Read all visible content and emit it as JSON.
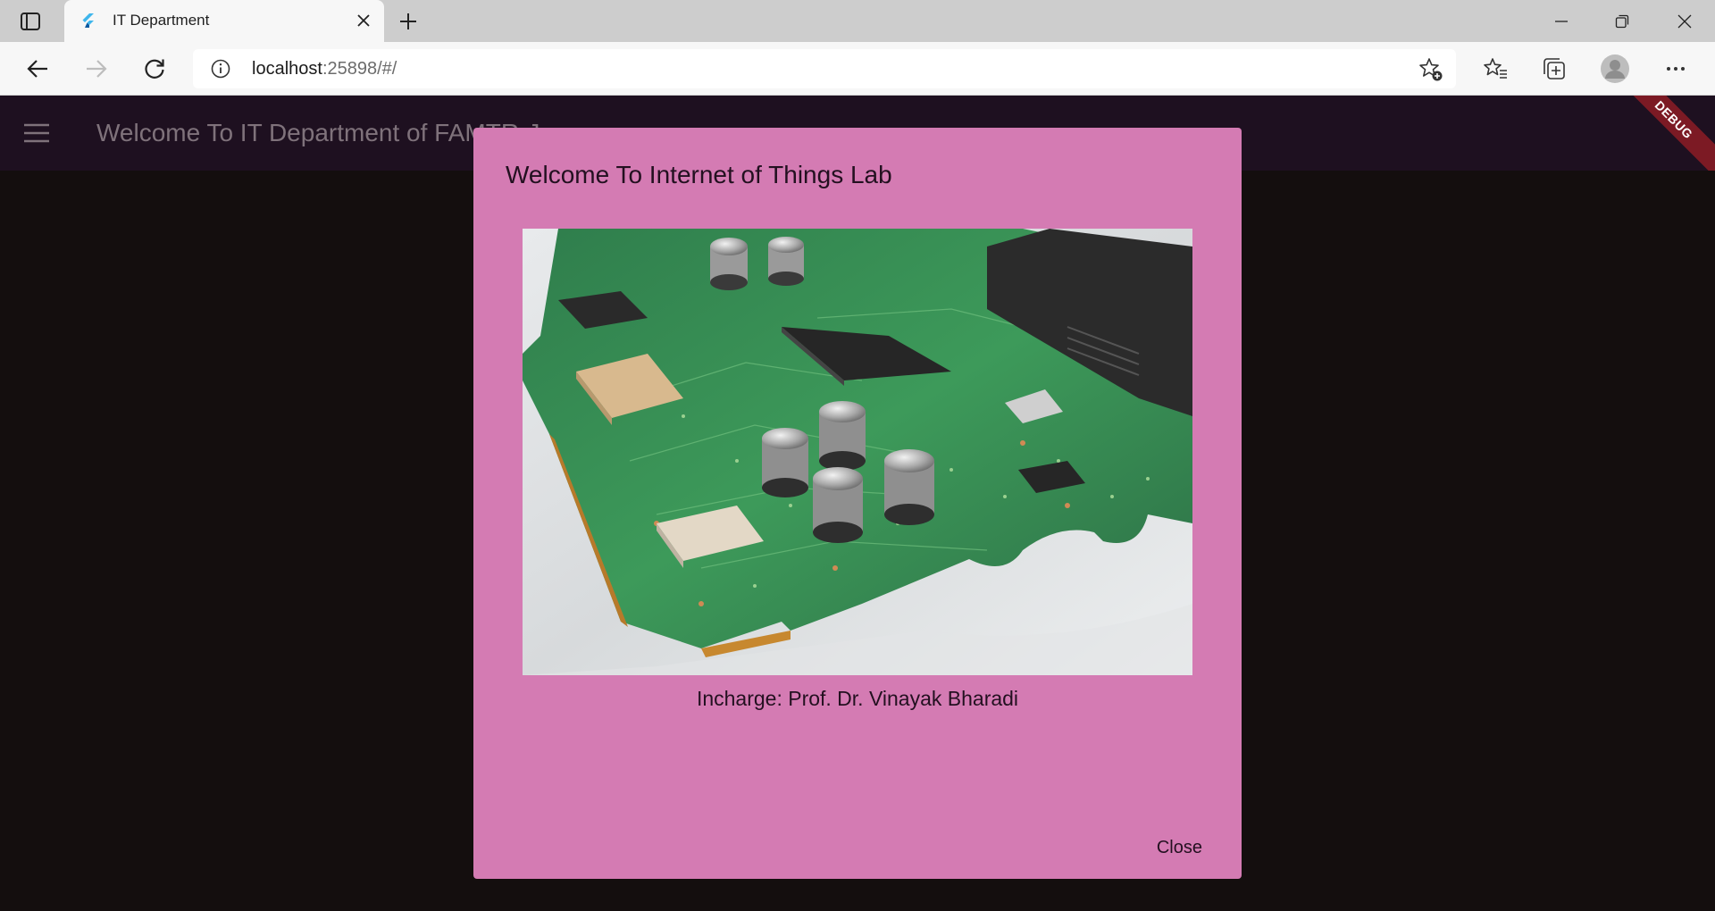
{
  "browser": {
    "tab_title": "IT Department",
    "url_host": "localhost",
    "url_rest": ":25898/#/",
    "icons": {
      "tab_actions": "tab-actions-icon",
      "favicon": "flutter-icon",
      "tab_close": "close-icon",
      "new_tab": "plus-icon",
      "minimize": "minimize-icon",
      "restore": "restore-icon",
      "window_close": "close-icon",
      "back": "back-arrow-icon",
      "forward": "forward-arrow-icon",
      "refresh": "refresh-icon",
      "site_info": "info-icon",
      "add_favorite": "star-add-icon",
      "favorites": "favorites-icon",
      "collections": "collections-icon",
      "profile": "avatar-icon",
      "more": "more-icon"
    }
  },
  "app": {
    "title": "Welcome To IT Department of FAMTRrJ",
    "debug_banner": "DEBUG",
    "colors": {
      "appbar": "#1e1020",
      "background": "#140e0e",
      "dialog": "#d47bb3"
    }
  },
  "dialog": {
    "title": "Welcome To Internet of Things Lab",
    "incharge": "Incharge: Prof. Dr. Vinayak Bharadi",
    "close_label": "Close"
  }
}
